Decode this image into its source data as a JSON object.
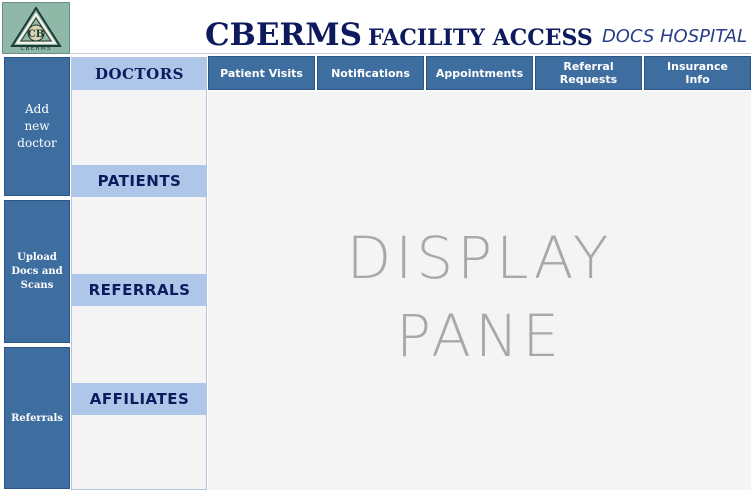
{
  "logo": {
    "monogram": "CB",
    "caption": "CBERMS"
  },
  "header": {
    "title_main": "CBERMS",
    "title_sub": "FACILITY ACCESS",
    "hospital": "DOCS HOSPITAL"
  },
  "actions": [
    {
      "label_lines": [
        "Add",
        "new",
        "doctor"
      ]
    },
    {
      "label_lines": [
        "Upload",
        "Docs and",
        "Scans"
      ]
    },
    {
      "label_lines": [
        "Referrals"
      ]
    }
  ],
  "sections": [
    "DOCTORS",
    "PATIENTS",
    "REFERRALS",
    "AFFILIATES"
  ],
  "tabs": [
    {
      "label": "Patient Visits"
    },
    {
      "label": "Notifications"
    },
    {
      "label": "Appointments"
    },
    {
      "label": "Referral Requests"
    },
    {
      "label": "Insurance Info"
    }
  ],
  "display_pane": {
    "line1": "DISPLAY",
    "line2": "PANE"
  },
  "colors": {
    "primary": "#3e6da0",
    "section_bg": "#aec6e8",
    "title_navy": "#0d1b5e",
    "logo_green": "#8fb8a8",
    "pane_bg": "#f4f4f5"
  }
}
